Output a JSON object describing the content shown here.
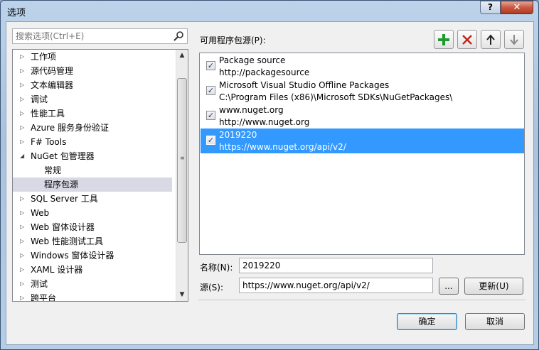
{
  "window": {
    "title": "选项",
    "help_label": "?",
    "close_label": "✕"
  },
  "search": {
    "placeholder": "搜索选项(Ctrl+E)"
  },
  "tree": {
    "items": [
      {
        "label": "工作项",
        "arrow": "▷"
      },
      {
        "label": "源代码管理",
        "arrow": "▷"
      },
      {
        "label": "文本编辑器",
        "arrow": "▷"
      },
      {
        "label": "调试",
        "arrow": "▷"
      },
      {
        "label": "性能工具",
        "arrow": "▷"
      },
      {
        "label": "Azure 服务身份验证",
        "arrow": "▷"
      },
      {
        "label": "F# Tools",
        "arrow": "▷"
      },
      {
        "label": "NuGet 包管理器",
        "arrow": "◢"
      },
      {
        "label": "常规",
        "arrow": ""
      },
      {
        "label": "程序包源",
        "arrow": ""
      },
      {
        "label": "SQL Server 工具",
        "arrow": "▷"
      },
      {
        "label": "Web",
        "arrow": "▷"
      },
      {
        "label": "Web 窗体设计器",
        "arrow": "▷"
      },
      {
        "label": "Web 性能测试工具",
        "arrow": "▷"
      },
      {
        "label": "Windows 窗体设计器",
        "arrow": "▷"
      },
      {
        "label": "XAML 设计器",
        "arrow": "▷"
      },
      {
        "label": "测试",
        "arrow": "▷"
      },
      {
        "label": "跨平台",
        "arrow": "▷"
      }
    ],
    "selected_index": 9
  },
  "sources": {
    "heading": "可用程序包源(P):",
    "items": [
      {
        "name": "Package source",
        "url": "http://packagesource",
        "checked": true
      },
      {
        "name": "Microsoft Visual Studio Offline Packages",
        "url": "C:\\Program Files (x86)\\Microsoft SDKs\\NuGetPackages\\",
        "checked": true
      },
      {
        "name": "www.nuget.org",
        "url": "http://www.nuget.org",
        "checked": true
      },
      {
        "name": "2019220",
        "url": "https://www.nuget.org/api/v2/",
        "checked": true
      }
    ],
    "selected_index": 3
  },
  "toolbar": {
    "add_icon": "plus-icon",
    "remove_icon": "x-icon",
    "up_icon": "arrow-up-icon",
    "down_icon": "arrow-down-icon",
    "add_color": "#1e9b2e",
    "remove_color": "#c0241a"
  },
  "form": {
    "name_label": "名称(N):",
    "name_value": "2019220",
    "source_label": "源(S):",
    "source_value": "https://www.nuget.org/api/v2/",
    "browse_label": "...",
    "update_label": "更新(U)"
  },
  "dialog": {
    "ok_label": "确定",
    "cancel_label": "取消"
  }
}
